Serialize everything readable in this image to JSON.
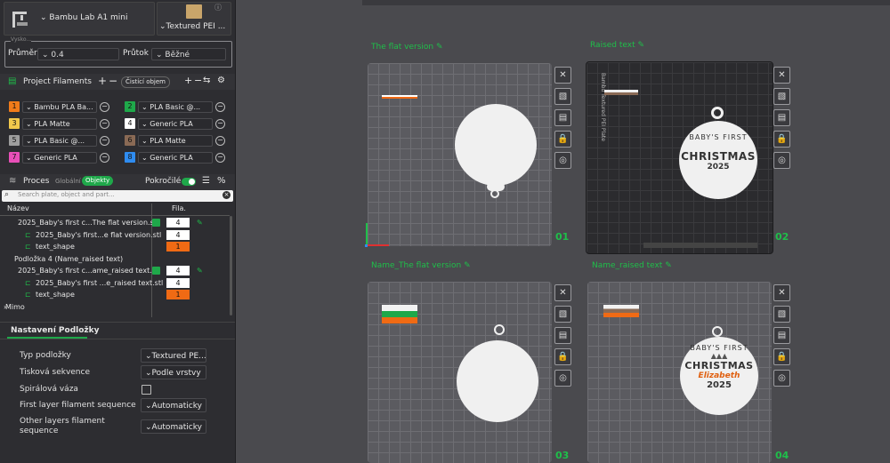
{
  "printer": {
    "name": "Bambu Lab A1 mini",
    "icon": "printer-icon"
  },
  "plate_type": {
    "label": "Textured PEI ...",
    "info_icon": "info-icon"
  },
  "nozzle": {
    "group_label": "Vysko...",
    "diameter_label": "Průměr",
    "diameter_value": "0.4",
    "flow_label": "Průtok",
    "flow_value": "Běžné"
  },
  "filaments": {
    "title": "Project Filaments",
    "action_label": "Čistící objem",
    "items": [
      {
        "num": "1",
        "color": "#f07b1a",
        "name": "Bambu PLA Ba..."
      },
      {
        "num": "2",
        "color": "#1fa84a",
        "name": "PLA Basic @..."
      },
      {
        "num": "3",
        "color": "#f2c94c",
        "name": "PLA Matte"
      },
      {
        "num": "4",
        "color": "#ffffff",
        "name": "Generic PLA"
      },
      {
        "num": "5",
        "color": "#9e9e9e",
        "name": "PLA Basic @..."
      },
      {
        "num": "6",
        "color": "#8a6a55",
        "name": "PLA Matte"
      },
      {
        "num": "7",
        "color": "#e84fb8",
        "name": "Generic PLA"
      },
      {
        "num": "8",
        "color": "#2f8cf0",
        "name": "Generic PLA"
      }
    ]
  },
  "process": {
    "title": "Proces",
    "global_label": "Globální",
    "objects_label": "Objekty",
    "advanced_label": "Pokročilé",
    "advanced_on": true
  },
  "search": {
    "placeholder": "Search plate, object and part..."
  },
  "tree": {
    "col_name": "Název",
    "col_fila": "Fila.",
    "rows": [
      {
        "indent": 20,
        "label": "2025_Baby's first c...The flat version.stl",
        "check": true,
        "fila": "4",
        "orange": false
      },
      {
        "indent": 30,
        "label": "2025_Baby's first...e flat version.stl",
        "check": false,
        "fila": "4",
        "orange": false
      },
      {
        "indent": 30,
        "label": "text_shape",
        "check": false,
        "fila": "1",
        "orange": true
      },
      {
        "indent": 16,
        "label": "Podložka 4 (Name_raised text)",
        "check": false,
        "fila": "",
        "orange": false
      },
      {
        "indent": 20,
        "label": "2025_Baby's first c...ame_raised text.stl",
        "check": true,
        "fila": "4",
        "orange": false
      },
      {
        "indent": 30,
        "label": "2025_Baby's first ...e_raised text.stl",
        "check": false,
        "fila": "4",
        "orange": false
      },
      {
        "indent": 30,
        "label": "text_shape",
        "check": false,
        "fila": "1",
        "orange": true
      },
      {
        "indent": 6,
        "label": "Mimo",
        "check": false,
        "fila": "",
        "orange": false
      }
    ]
  },
  "plate_settings": {
    "title": "Nastavení Podložky",
    "rows": [
      {
        "label": "Typ podložky",
        "value": "Textured PE..."
      },
      {
        "label": "Tisková sekvence",
        "value": "Podle vrstvy"
      },
      {
        "label": "Spirálová váza",
        "value": ""
      },
      {
        "label": "First layer filament sequence",
        "value": "Automaticky"
      },
      {
        "label": "Other layers filament sequence",
        "value": "Automaticky"
      }
    ]
  },
  "plates": [
    {
      "title": "The flat version",
      "num": "01"
    },
    {
      "title": "Raised text",
      "num": "02",
      "bed_label": "Bambu Textured PEI Plate"
    },
    {
      "title": "Name_The flat version",
      "num": "03"
    },
    {
      "title": "Name_raised text",
      "num": "04"
    }
  ],
  "ornament_raised": {
    "line1": "BABY'S FIRST",
    "line2": "CHRISTMAS",
    "year": "2025"
  },
  "ornament_name": {
    "line1": "BABY'S FIRST",
    "line2": "CHRISTMAS",
    "name": "Elizabeth",
    "year": "2025"
  },
  "colors": {
    "accent": "#1fbf4a",
    "orange": "#f06a14"
  }
}
